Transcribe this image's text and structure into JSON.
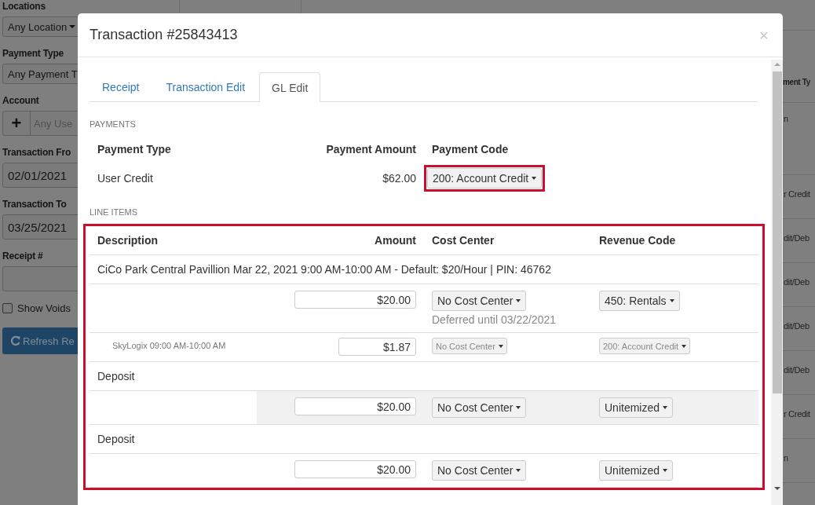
{
  "sidebar": {
    "filters": [
      {
        "kind": "select",
        "label": "Locations",
        "value": "Any Location"
      },
      {
        "kind": "select",
        "label": "Payment Type",
        "value": "Any Payment T"
      },
      {
        "kind": "account",
        "label": "Account",
        "button": "+",
        "placeholder": "Any Use"
      },
      {
        "kind": "date",
        "label": "Transaction Fro",
        "value": "02/01/2021"
      },
      {
        "kind": "date",
        "label": "Transaction To",
        "value": "03/25/2021"
      },
      {
        "kind": "text",
        "label": "Receipt #"
      }
    ],
    "show_voids": {
      "label": "Show Voids",
      "checked": false
    },
    "refresh_button": "Refresh Re"
  },
  "background_table": {
    "column_1": "ment Ty",
    "cells": [
      "n",
      "r Credit",
      "dit/Deb",
      "dit/Deb",
      "dit/Deb",
      "dit/Deb",
      "r Credit",
      "n"
    ]
  },
  "modal": {
    "title": "Transaction #25843413",
    "close": "×",
    "tabs": [
      {
        "label": "Receipt",
        "selected": false
      },
      {
        "label": "Transaction Edit",
        "selected": false
      },
      {
        "label": "GL Edit",
        "selected": true
      }
    ],
    "payments": {
      "heading": "PAYMENTS",
      "columns": [
        "Payment Type",
        "Payment Amount",
        "Payment Code"
      ],
      "rows": [
        {
          "type": "User Credit",
          "amount": "$62.00",
          "code": "200: Account Credit",
          "highlighted": true
        }
      ]
    },
    "line_items": {
      "heading": "LINE ITEMS",
      "highlighted": true,
      "columns": [
        "Description",
        "Amount",
        "Cost Center",
        "Revenue Code"
      ],
      "rows": [
        {
          "kind": "title",
          "description": "CiCo Park Central Pavillion Mar 22, 2021 9:00 AM-10:00 AM - Default: $20/Hour | PIN: 46762"
        },
        {
          "kind": "allocation",
          "small": false,
          "highlighted": false,
          "amount": "$20.00",
          "cost_center": "No Cost Center",
          "note": "Deferred until 03/22/2021",
          "revenue_code": "450: Rentals"
        },
        {
          "kind": "allocation",
          "small": true,
          "highlighted": false,
          "description": "SkyLogix 09:00 AM-10:00 AM",
          "amount": "$1.87",
          "cost_center": "No Cost Center",
          "revenue_code": "200: Account Credit"
        },
        {
          "kind": "title",
          "description": "Deposit"
        },
        {
          "kind": "allocation",
          "small": false,
          "highlighted": true,
          "amount": "$20.00",
          "cost_center": "No Cost Center",
          "revenue_code": "Unitemized"
        },
        {
          "kind": "title",
          "description": "Deposit"
        },
        {
          "kind": "allocation",
          "small": false,
          "highlighted": false,
          "amount": "$20.00",
          "cost_center": "No Cost Center",
          "revenue_code": "Unitemized"
        }
      ]
    }
  }
}
